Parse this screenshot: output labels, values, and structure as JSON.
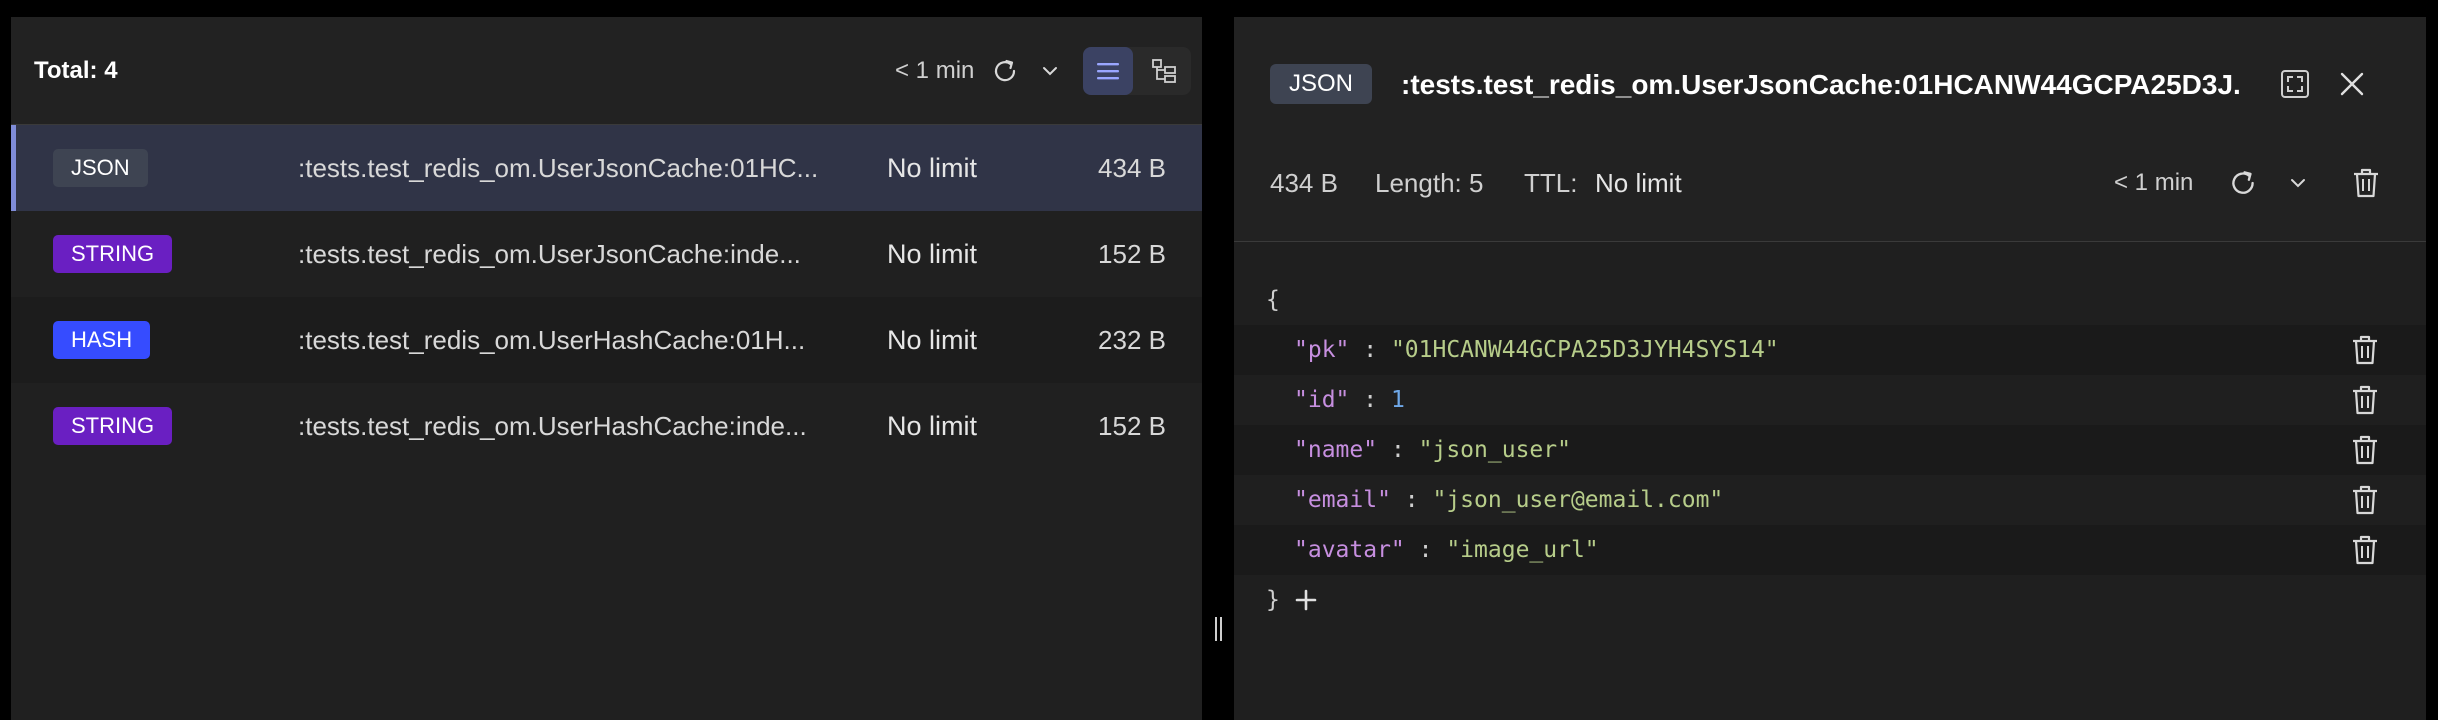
{
  "key_list": {
    "total_label": "Total: 4",
    "refresh_time": "< 1 min",
    "view_modes": [
      "list-view-icon",
      "tree-view-icon"
    ],
    "active_view": "list",
    "rows": [
      {
        "type": "JSON",
        "type_color": "#3e4452",
        "name": ":tests.test_redis_om.UserJsonCache:01HC...",
        "ttl": "No limit",
        "size": "434 B",
        "selected": true
      },
      {
        "type": "STRING",
        "type_color": "#6a1fc2",
        "name": ":tests.test_redis_om.UserJsonCache:inde...",
        "ttl": "No limit",
        "size": "152 B",
        "selected": false
      },
      {
        "type": "HASH",
        "type_color": "#364cff",
        "name": ":tests.test_redis_om.UserHashCache:01H...",
        "ttl": "No limit",
        "size": "232 B",
        "selected": false
      },
      {
        "type": "STRING",
        "type_color": "#6a1fc2",
        "name": ":tests.test_redis_om.UserHashCache:inde...",
        "ttl": "No limit",
        "size": "152 B",
        "selected": false
      }
    ]
  },
  "key_details": {
    "type": "JSON",
    "key_name": ":tests.test_redis_om.UserJsonCache:01HCANW44GCPA25D3J...",
    "size": "434 B",
    "length": "Length: 5",
    "ttl_label": "TTL:",
    "ttl_value": "No limit",
    "refresh_time": "< 1 min",
    "json": {
      "open_brace": "{",
      "close_brace": "}",
      "fields": [
        {
          "key": "\"pk\"",
          "sep": " : ",
          "value": "\"01HCANW44GCPA25D3JYH4SYS14\"",
          "kind": "string"
        },
        {
          "key": "\"id\"",
          "sep": " : ",
          "value": "1",
          "kind": "number"
        },
        {
          "key": "\"name\"",
          "sep": " : ",
          "value": "\"json_user\"",
          "kind": "string"
        },
        {
          "key": "\"email\"",
          "sep": " : ",
          "value": "\"json_user@email.com\"",
          "kind": "string"
        },
        {
          "key": "\"avatar\"",
          "sep": " : ",
          "value": "\"image_url\"",
          "kind": "string"
        }
      ]
    }
  },
  "colors": {
    "accent": "#7f8cd8",
    "json_key": "#c78fe0",
    "json_string": "#b7cd8a",
    "json_number": "#6fa8e8"
  }
}
